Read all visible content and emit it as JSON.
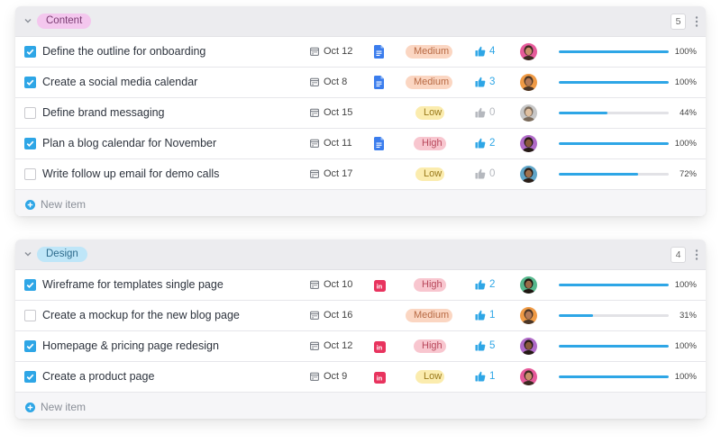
{
  "groups": [
    {
      "name": "Content",
      "count": "5",
      "tag_style": "content",
      "new_item_label": "New item",
      "rows": [
        {
          "title": "Define the outline for onboarding",
          "checked": true,
          "date": "Oct 12",
          "attachment": "google-doc",
          "priority": "Medium",
          "likes": "4",
          "likes_active": true,
          "avatar": "a1",
          "progress": 100,
          "progress_label": "100%"
        },
        {
          "title": "Create a social media calendar",
          "checked": true,
          "date": "Oct 8",
          "attachment": "google-doc",
          "priority": "Medium",
          "likes": "3",
          "likes_active": true,
          "avatar": "a2",
          "progress": 100,
          "progress_label": "100%"
        },
        {
          "title": "Define brand messaging",
          "checked": false,
          "date": "Oct 15",
          "attachment": "",
          "priority": "Low",
          "likes": "0",
          "likes_active": false,
          "avatar": "a3",
          "progress": 44,
          "progress_label": "44%"
        },
        {
          "title": "Plan a blog calendar for November",
          "checked": true,
          "date": "Oct 11",
          "attachment": "google-doc",
          "priority": "High",
          "likes": "2",
          "likes_active": true,
          "avatar": "a4",
          "progress": 100,
          "progress_label": "100%"
        },
        {
          "title": "Write follow up email for demo calls",
          "checked": false,
          "date": "Oct 17",
          "attachment": "",
          "priority": "Low",
          "likes": "0",
          "likes_active": false,
          "avatar": "a5",
          "progress": 72,
          "progress_label": "72%"
        }
      ]
    },
    {
      "name": "Design",
      "count": "4",
      "tag_style": "design",
      "new_item_label": "New item",
      "rows": [
        {
          "title": "Wireframe for templates single page",
          "checked": true,
          "date": "Oct 10",
          "attachment": "invision",
          "priority": "High",
          "likes": "2",
          "likes_active": true,
          "avatar": "a6",
          "progress": 100,
          "progress_label": "100%"
        },
        {
          "title": "Create a mockup for the new blog page",
          "checked": false,
          "date": "Oct 16",
          "attachment": "",
          "priority": "Medium",
          "likes": "1",
          "likes_active": true,
          "avatar": "a2",
          "progress": 31,
          "progress_label": "31%"
        },
        {
          "title": "Homepage & pricing page redesign",
          "checked": true,
          "date": "Oct 12",
          "attachment": "invision",
          "priority": "High",
          "likes": "5",
          "likes_active": true,
          "avatar": "a4",
          "progress": 100,
          "progress_label": "100%"
        },
        {
          "title": "Create a product page",
          "checked": true,
          "date": "Oct 9",
          "attachment": "invision",
          "priority": "Low",
          "likes": "1",
          "likes_active": true,
          "avatar": "a1",
          "progress": 100,
          "progress_label": "100%"
        }
      ]
    }
  ],
  "colors": {
    "accent": "#2ea6e6",
    "medium_bg": "#fbd6c2",
    "medium_fg": "#b86a44",
    "low_bg": "#fbecae",
    "low_fg": "#9a7a1c",
    "high_bg": "#f8c6cf",
    "high_fg": "#b8475b",
    "likes_active": "#2ea6e6",
    "likes_inactive": "#b5b8be"
  }
}
